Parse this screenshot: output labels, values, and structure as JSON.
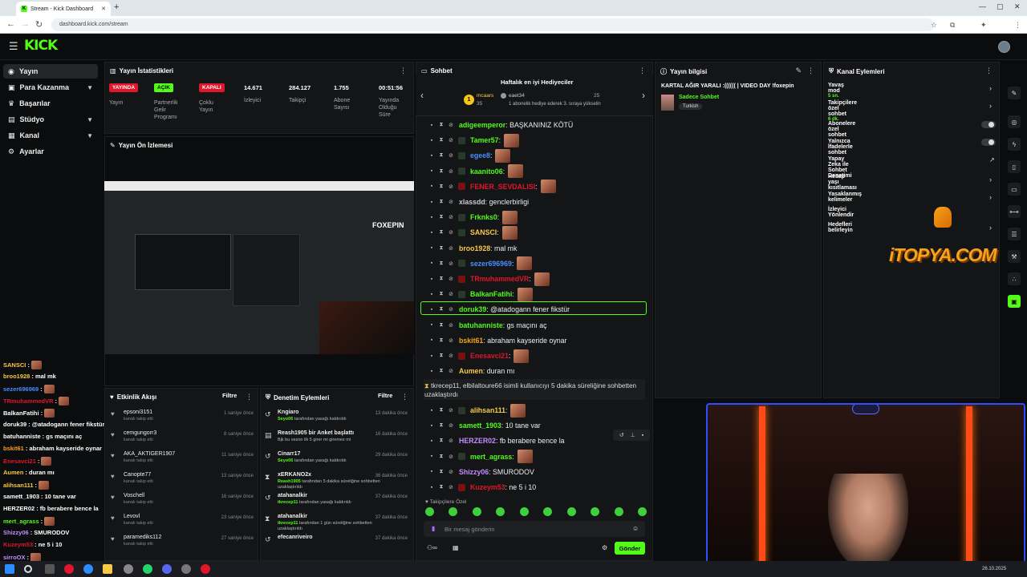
{
  "browser": {
    "tab_title": "Stream - Kick Dashboard",
    "url": "dashboard.kick.com/stream"
  },
  "brand": {
    "logo_text": "KICK",
    "accent": "#53fc18"
  },
  "sidebar": {
    "items": [
      {
        "label": "Yayın",
        "icon": "broadcast-icon",
        "active": true
      },
      {
        "label": "Para Kazanma",
        "icon": "money-icon"
      },
      {
        "label": "Başarılar",
        "icon": "trophy-icon"
      },
      {
        "label": "Stüdyo",
        "icon": "studio-icon"
      },
      {
        "label": "Kanal",
        "icon": "channel-icon"
      },
      {
        "label": "Ayarlar",
        "icon": "gear-icon"
      }
    ]
  },
  "stats": {
    "title": "Yayın İstatistikleri",
    "badges": [
      {
        "text": "YAYINDA",
        "label": "Yayın",
        "color": "#e0162b"
      },
      {
        "text": "AÇIK",
        "label": "Partnerlik Gelir Programı",
        "color": "#53fc18"
      },
      {
        "text": "KAPALI",
        "label": "Çoklu Yayın",
        "color": "#e0162b"
      }
    ],
    "values": [
      {
        "value": "14.671",
        "label": "İzleyici"
      },
      {
        "value": "284.127",
        "label": "Takipçi"
      },
      {
        "value": "1.755",
        "label": "Abone Sayısı"
      },
      {
        "value": "00:51:56",
        "label": "Yayında Olduğu Süre"
      }
    ]
  },
  "preview": {
    "title": "Yayın Ön İzlemesi"
  },
  "activity": {
    "title": "Etkinlik Akışı",
    "filter": "Filtre",
    "rows": [
      {
        "name": "epsoni3151",
        "sub": "kanalı takip etti",
        "time": "1 saniye önce"
      },
      {
        "name": "cemgungorr3",
        "sub": "kanalı takip etti",
        "time": "8 saniye önce"
      },
      {
        "name": "AKA_AKTIGER1907",
        "sub": "kanalı takip etti",
        "time": "11 saniye önce"
      },
      {
        "name": "Canopte77",
        "sub": "kanalı takip etti",
        "time": "13 saniye önce"
      },
      {
        "name": "Voschell",
        "sub": "kanalı takip etti",
        "time": "16 saniye önce"
      },
      {
        "name": "Levovl",
        "sub": "kanalı takip etti",
        "time": "23 saniye önce"
      },
      {
        "name": "paramediks112",
        "sub": "kanalı takip etti",
        "time": "27 saniye önce"
      }
    ]
  },
  "moderation": {
    "title": "Denetim Eylemleri",
    "filter": "Filtre",
    "rows": [
      {
        "icon": "undo-icon",
        "name": "Kngiaro",
        "actor": "Seyo06",
        "sub": "tarafından yasağı kaldırıldı",
        "time": "13 dakika önce"
      },
      {
        "icon": "poll-icon",
        "name": "Reash1905 bir Anket başlattı",
        "actor": "",
        "sub": "Bjk bu sezon ilk 5 girer mi giremez mi",
        "time": "16 dakika önce"
      },
      {
        "icon": "undo-icon",
        "name": "Cinarr17",
        "actor": "Seyo06",
        "sub": "tarafından yasağı kaldırıldı",
        "time": "29 dakika önce"
      },
      {
        "icon": "hourglass-icon",
        "name": "xERKANO2x",
        "actor": "Reash1905",
        "sub": "tarafından 5 dakika süreliğine sohbetten uzaklaştırıldı",
        "time": "36 dakika önce"
      },
      {
        "icon": "undo-icon",
        "name": "atahanalkir",
        "actor": "tkrecep11",
        "sub": "tarafından yasağı kaldırıldı",
        "time": "37 dakika önce"
      },
      {
        "icon": "hourglass-icon",
        "name": "atahanalkir",
        "actor": "tkrecep11",
        "sub": "tarafından 1 gün süreliğine sohbetten uzaklaştırıldı",
        "time": "37 dakika önce"
      },
      {
        "icon": "undo-icon",
        "name": "efecanriveiro",
        "actor": "",
        "sub": "",
        "time": "37 dakika önce"
      }
    ]
  },
  "chat": {
    "title": "Sohbet",
    "gifters_title": "Haftalık en iyi Hediyeciler",
    "gifter1": {
      "name": "mcaars",
      "count": "35"
    },
    "gifter2": {
      "name": "eaet34",
      "count": "25"
    },
    "gifter_note": "1 abonelik hediye ederek 3. sıraya yükselin",
    "messages": [
      {
        "user": "adigeemperor",
        "color": "#53fc18",
        "text": ": BAŞKANINIZ KÖTÜ",
        "emote": false
      },
      {
        "user": "Tamer57",
        "color": "#53fc18",
        "text": ":",
        "emote": true
      },
      {
        "user": "egee8",
        "color": "#4a8cff",
        "text": ":",
        "emote": true
      },
      {
        "user": "kaanito06",
        "color": "#53fc18",
        "text": ":",
        "emote": true
      },
      {
        "user": "FENER_SEVDALISI",
        "color": "#e0162b",
        "text": ":",
        "emote": true
      },
      {
        "user": "xlassdd",
        "color": "#cccccc",
        "text": ": genclerbirligi",
        "emote": false
      },
      {
        "user": "Frknks0",
        "color": "#53fc18",
        "text": ":",
        "emote": true
      },
      {
        "user": "SANSCI",
        "color": "#f7c948",
        "text": ":",
        "emote": true
      },
      {
        "user": "broo1928",
        "color": "#f7c948",
        "text": ": mal mk",
        "emote": false
      },
      {
        "user": "sezer696969",
        "color": "#4a8cff",
        "text": ":",
        "emote": true
      },
      {
        "user": "TRmuhammedVR",
        "color": "#e0162b",
        "text": ":",
        "emote": true
      },
      {
        "user": "BalkanFatihi",
        "color": "#53fc18",
        "text": ":",
        "emote": true
      },
      {
        "user": "doruk39",
        "color": "#53fc18",
        "text": ": @atadogann fener fikstür",
        "emote": false,
        "highlight": true
      },
      {
        "user": "batuhanniste",
        "color": "#53fc18",
        "text": ": gs maçını aç",
        "emote": false
      },
      {
        "user": "bskit61",
        "color": "#f7a21b",
        "text": ": abraham kayseride oynar",
        "emote": false
      },
      {
        "user": "Enesavci21",
        "color": "#e0162b",
        "text": ":",
        "emote": true
      },
      {
        "user": "Aumen",
        "color": "#f7c948",
        "text": ": duran mı",
        "emote": false
      }
    ],
    "system_message": "tkrecep11, elbilaltoure66 isimli kullanıcıyı 5 dakika süreliğine sohbetten uzaklaştırdı",
    "messages2": [
      {
        "user": "alihsan111",
        "color": "#f7c948",
        "text": ":",
        "emote": true
      },
      {
        "user": "samett_1903",
        "color": "#53fc18",
        "text": ": 10 tane var",
        "emote": false
      },
      {
        "user": "HERZER02",
        "color": "#c58cff",
        "text": ": fb beraberе bence la",
        "emote": false
      },
      {
        "user": "mert_agrass",
        "color": "#53fc18",
        "text": ":",
        "emote": true
      },
      {
        "user": "Shizzy06",
        "color": "#c58cff",
        "text": ": SMURODOV",
        "emote": false
      },
      {
        "user": "Kuzeym53",
        "color": "#e0162b",
        "text": ": ne 5 i 10",
        "emote": false
      }
    ],
    "followers_only": "Takipçilere Özel",
    "input_placeholder": "Bir mesaj gönderin",
    "send_label": "Gönder"
  },
  "stream_info": {
    "title": "Yayın bilgisi",
    "stream_title": "KARTAL AĞIR YARALI :(((((( | VIDEO DAY !foxepin",
    "category": "Sadece Sohbet",
    "tag": "Turkish"
  },
  "channel_actions": {
    "title": "Kanal Eylemleri",
    "items": [
      {
        "label": "Yavaş mod",
        "sub": "5 sn.",
        "control": "chevron"
      },
      {
        "label": "Takipçilere özel sohbet",
        "sub": "6 dk.",
        "control": "chevron"
      },
      {
        "label": "Abonelere özel sohbet",
        "sub": "",
        "control": "toggle"
      },
      {
        "label": "Yalnızca İfadelerle sohbet",
        "sub": "",
        "control": "toggle"
      },
      {
        "label": "Yapay Zeka ile Sohbet Denetimi",
        "sub": "",
        "control": "external"
      },
      {
        "label": "Hesap yaşı kısıtlaması",
        "sub": "",
        "control": "chevron"
      },
      {
        "label": "Yasaklanmış kelimeler",
        "sub": "",
        "control": "chevron"
      },
      {
        "label": "İzleyici Yönlendir",
        "sub": "",
        "control": "none"
      },
      {
        "label": "Hedefleri belirleyin",
        "sub": "",
        "control": "chevron"
      }
    ]
  },
  "watermark": "iTOPYA.COM",
  "overlay_chat": [
    {
      "user": "SANSCI",
      "color": "#f7c948",
      "text": ":",
      "emote": true
    },
    {
      "user": "broo1928",
      "color": "#f7c948",
      "text": ": mal mk",
      "emote": false
    },
    {
      "user": "sezer696969",
      "color": "#4a8cff",
      "text": ":",
      "emote": true
    },
    {
      "user": "TRmuhammedVR",
      "color": "#e0162b",
      "text": ":",
      "emote": true
    },
    {
      "user": "BalkanFatihi",
      "color": "#ffffff",
      "text": ":",
      "emote": true
    },
    {
      "user": "doruk39",
      "color": "#ffffff",
      "text": ": @atadogann fener fikstür",
      "emote": false
    },
    {
      "user": "batuhanniste",
      "color": "#ffffff",
      "text": ": gs maçını aç",
      "emote": false
    },
    {
      "user": "bskit61",
      "color": "#f7a21b",
      "text": ": abraham kayseride oynar",
      "emote": false
    },
    {
      "user": "Enesavci21",
      "color": "#e0162b",
      "text": ":",
      "emote": true
    },
    {
      "user": "Aumen",
      "color": "#f7c948",
      "text": ": duran mı",
      "emote": false
    },
    {
      "user": "alihsan111",
      "color": "#f7c948",
      "text": ":",
      "emote": true
    },
    {
      "user": "samett_1903",
      "color": "#ffffff",
      "text": ": 10 tane var",
      "emote": false
    },
    {
      "user": "HERZER02",
      "color": "#ffffff",
      "text": ": fb beraberе bence la",
      "emote": false
    },
    {
      "user": "mert_agrass",
      "color": "#53fc18",
      "text": ":",
      "emote": true
    },
    {
      "user": "Shizzy06",
      "color": "#c58cff",
      "text": ": SMURODOV",
      "emote": false
    },
    {
      "user": "Kuzeym53",
      "color": "#e0162b",
      "text": ": ne 5 i 10",
      "emote": false
    },
    {
      "user": "sirroOX",
      "color": "#c58cff",
      "text": ":",
      "emote": true
    }
  ],
  "taskbar": {
    "date": "26.10.2025"
  }
}
